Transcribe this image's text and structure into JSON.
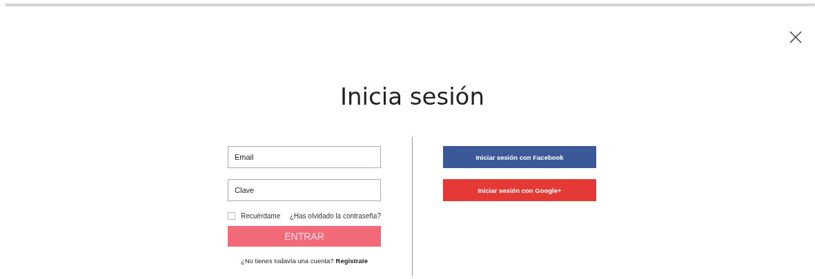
{
  "title": "Inicia sesión",
  "fields": [
    {
      "placeholder": "Email"
    },
    {
      "placeholder": "Clave"
    }
  ],
  "remember": {
    "label": "Recuérdame",
    "checked": false
  },
  "forgot_link": "¿Has olvidado la contraseña?",
  "submit": "ENTRAR",
  "signup": {
    "prompt": "¿No tienes todavía una cuenta?",
    "link": "Regístrate"
  },
  "social_buttons": [
    {
      "kind": "facebook",
      "label": "Iniciar sesión con Facebook"
    },
    {
      "kind": "google",
      "label": "Iniciar sesión con Google+"
    }
  ]
}
